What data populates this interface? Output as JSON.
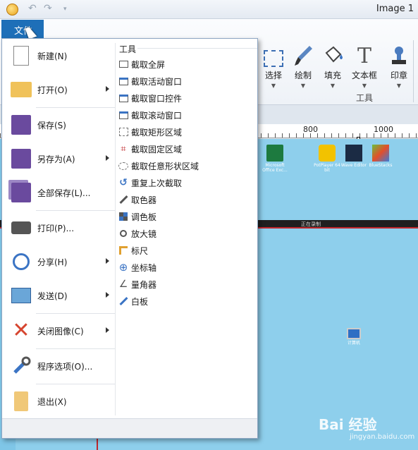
{
  "window": {
    "title": "Image 1"
  },
  "file_tab": {
    "label": "文件"
  },
  "ribbon": {
    "tools": [
      {
        "label": "选择",
        "icon": "select-icon"
      },
      {
        "label": "绘制",
        "icon": "brush-icon"
      },
      {
        "label": "填充",
        "icon": "fill-bucket-icon"
      },
      {
        "label": "文本框",
        "icon": "text-icon"
      },
      {
        "label": "印章",
        "icon": "stamp-icon"
      }
    ],
    "group_label": "工具"
  },
  "ruler": {
    "marks": [
      "800",
      "1000"
    ]
  },
  "file_menu": {
    "items": [
      {
        "label": "新建(N)",
        "icon": "new-document-icon"
      },
      {
        "label": "打开(O)",
        "icon": "open-folder-icon",
        "submenu": true
      },
      {
        "label": "保存(S)",
        "icon": "save-icon"
      },
      {
        "label": "另存为(A)",
        "icon": "save-as-icon",
        "submenu": true
      },
      {
        "label": "全部保存(L)...",
        "icon": "save-all-icon"
      },
      {
        "label": "打印(P)...",
        "icon": "print-icon"
      },
      {
        "label": "分享(H)",
        "icon": "share-icon",
        "submenu": true
      },
      {
        "label": "发送(D)",
        "icon": "send-icon",
        "submenu": true
      },
      {
        "label": "关闭图像(C)",
        "icon": "close-image-icon",
        "submenu": true
      },
      {
        "label": "程序选项(O)...",
        "icon": "options-icon"
      },
      {
        "label": "退出(X)",
        "icon": "exit-icon"
      }
    ],
    "tools_title": "工具",
    "tools": [
      {
        "label": "截取全屏",
        "icon": "capture-fullscreen-icon"
      },
      {
        "label": "截取活动窗口",
        "icon": "capture-window-icon"
      },
      {
        "label": "截取窗口控件",
        "icon": "capture-control-icon"
      },
      {
        "label": "截取滚动窗口",
        "icon": "capture-scroll-icon"
      },
      {
        "label": "截取矩形区域",
        "icon": "capture-rect-icon"
      },
      {
        "label": "截取固定区域",
        "icon": "capture-fixed-icon"
      },
      {
        "label": "截取任意形状区域",
        "icon": "capture-freehand-icon"
      },
      {
        "label": "重复上次截取",
        "icon": "repeat-capture-icon"
      },
      {
        "label": "取色器",
        "icon": "color-picker-icon"
      },
      {
        "label": "调色板",
        "icon": "palette-icon"
      },
      {
        "label": "放大镜",
        "icon": "magnifier-icon"
      },
      {
        "label": "标尺",
        "icon": "ruler-icon"
      },
      {
        "label": "坐标轴",
        "icon": "crosshair-icon"
      },
      {
        "label": "量角器",
        "icon": "protractor-icon"
      },
      {
        "label": "白板",
        "icon": "whiteboard-icon"
      }
    ]
  },
  "desktop": {
    "icons": [
      {
        "label": "Microsoft Office Exc...",
        "icon": "excel-icon"
      },
      {
        "label": "PotPlayer 64 bit",
        "icon": "potplayer-icon"
      },
      {
        "label": "Wave Editor",
        "icon": "wave-icon"
      },
      {
        "label": "BlueStacks",
        "icon": "bluestacks-icon"
      },
      {
        "label": "计算机",
        "icon": "computer-icon"
      }
    ],
    "band_text": "正在录制"
  },
  "watermark": {
    "text": "Bai 经验",
    "sub": "jingyan.baidu.com"
  }
}
